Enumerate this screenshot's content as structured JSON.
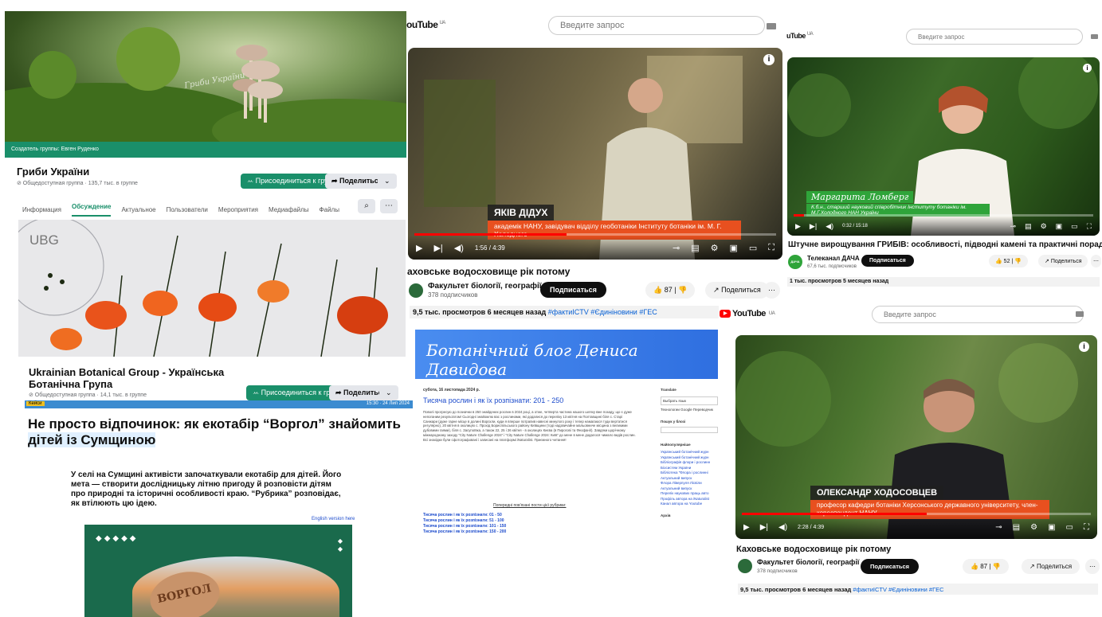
{
  "fb1": {
    "creator": "Создатель группы: Евген Руденко",
    "watermark": "Гриби України",
    "name": "Гриби України",
    "meta": "⊘ Общедоступная группа · 135,7 тыс. в группе",
    "join": "ꕀ Присоединиться к группе",
    "share": "➦ Поделиться",
    "more": "⌄",
    "tabs": [
      "Информация",
      "Обсуждение",
      "Актуальное",
      "Пользователи",
      "Мероприятия",
      "Медиафайлы",
      "Файлы"
    ]
  },
  "fb2": {
    "logo": "UBG",
    "name1": "Ukrainian Botanical Group - Українська",
    "name2": "Ботанічна Група",
    "meta": "⊘ Общедоступная группа · 14,1 тыс. в группе",
    "join": "ꕀ Присоединиться к группе",
    "share": "➦ Поделиться",
    "more": "⌄"
  },
  "article": {
    "tag": "Кейси",
    "date": "15:30 · 24 Лип 2024",
    "headline1": "Не просто відпочинок: як екотабір “Воргол” знайомить",
    "headline2": "дітей із Сумщиною",
    "lead": "У селі на Сумщині активісти започаткували екотабір для дітей. Його мета — створити дослідницьку літню пригоду й розповісти дітям про природні та історичні особливості краю. “Рубрика” розповідає, як втілюють цю ідею.",
    "english": "English version here",
    "sign": "ВОРГОЛ"
  },
  "yt1": {
    "logo": "ouTube",
    "logo_sup": "UA",
    "search": "Введите запрос",
    "person": "ЯКІВ ДІДУХ",
    "role": "академік НАНУ, завідувач відділу геоботаніки Інституту ботаніки ім. М. Г. Холодного",
    "time": "1:56 / 4:39",
    "progress": 0.42,
    "title": "аховське водосховище рік потому",
    "channel": "Факультет біології, географії ...",
    "subs": "378 подписчиков",
    "subscribe": "Подписаться",
    "likes": "87",
    "share": "Поделиться",
    "stats": "9,5 тыс. просмотров  6 месяцев назад",
    "tags": "#фактиICTV #Єдиніновини #ГЕС"
  },
  "yt2": {
    "logo": "uTube",
    "logo_sup": "UA",
    "search": "Введите запрос",
    "person": "Маргарита Ломберг",
    "role": "К.б.н., старший науковий співробітник Інституту ботаніки ім. М.Г.Холодного НАН України",
    "time": "0:32 / 15:18",
    "progress": 0.035,
    "title": "Штучне вирощування ГРИБІВ: особливості, підводні камені та практичні поради",
    "channel": "Телеканал ДАЧА",
    "channel_logo": "ДАЧА",
    "subs": "67,6 тыс. подписчиков",
    "subscribe": "Подписаться",
    "likes": "52",
    "share": "Поделиться",
    "stats": "1 тыс. просмотров  5 месяцев назад"
  },
  "blog": {
    "title": "Ботанічний блог Дениса Давидова",
    "date": "субота, 16 листопада 2024 р.",
    "post": "Тисяча рослин і як їх розпізнати: 201 - 250",
    "body": "Поволі прогресую до позначки в 250 знайдених рослин в 2024 році, а отже, четверта частина нашого шляху вже позаду, що є дуже непоганим результатом! Сьогодні знайомлю вас з рослинами, які додалися до переліку 13 квітня на Полтавщині біля с. Старі Санжари (дуже гарне місце в долині Ворскли, куди я вперше потрапив навесні минулого року і тепер намагаюся туди вертатися регулярно), 20 квітня в околицях с. Прохід Бориспільського району Київщини (тоді надзвичайне мальовниче місцина з великими дубовими гаями), біля с. Засупоївка, а також 22, 25 і 26 квітня - в околицях Києва (в Пирогові та Феофанії). Завдяки щорічному міжнародному заходу “City Nature Challenge 2024” і “City Nature Challenge 2024: Київ” до мене в мене додалося чимало видів рослин. Всі знахідки були сфотографовані і записані на платформі iNaturalist. Приємного читання!",
    "related": "Попередні пов'язані пости цієї рубрики:",
    "links": [
      "Тисяча рослин і як їх розпізнати: 01 - 50",
      "Тисяча рослин і як їх розпізнати: 51 - 100",
      "Тисяча рослин і як їх розпізнати: 101 - 150",
      "Тисяча рослин і як їх розпізнати: 150 - 200"
    ],
    "translate": "Translate",
    "lang_select": "Выбрать язык",
    "powered": "Технологии Google Переводчик",
    "search_label": "Пошук у блозі",
    "fav_label": "Найпопулярніше",
    "fav": [
      "Український ботанічний журн",
      "Український ботанічний журн",
      "Бібліографія флори і рослинн Біосистем України",
      "Бібліотека \"Флора і рослинні Актуальний випуск",
      "Флора Ліверпуля Лісвіли Актуальний випуск",
      "Перелік наукових праць авто",
      "Профіль автора на iNaturalist",
      "Канал автора на Youtube"
    ],
    "archive": "Архів"
  },
  "yt3": {
    "logo": "YouTube",
    "logo_sup": "UA",
    "search": "Введите запрос",
    "person": "ОЛЕКСАНДР ХОДОСОВЦЕВ",
    "role": "професор кафедри ботаніки Херсонського державного університету, член-кореспондент НАНУ",
    "time": "2:28 / 4:39",
    "progress": 0.53,
    "title": "Каховське водосховище рік потому",
    "channel": "Факультет біології, географії ...",
    "subs": "378 подписчиков",
    "subscribe": "Подписаться",
    "likes": "87",
    "share": "Поделиться",
    "stats": "9,5 тыс. просмотров  6 месяцев назад",
    "tags": "#фактиICTV #Єдиніновини #ГЕС"
  },
  "icons": {
    "play": "▶",
    "next": "▶|",
    "volume": "◀)",
    "info": "i",
    "more": "⋯",
    "thumb": "👍",
    "dislike": "👎",
    "share": "↗"
  },
  "colors": {
    "fb_green": "#1a8f6a",
    "yt_red": "#ff0000",
    "lower_orange": "#e8501f",
    "blog_blue": "#4a8df0",
    "link_blue": "#1c4bcc"
  }
}
